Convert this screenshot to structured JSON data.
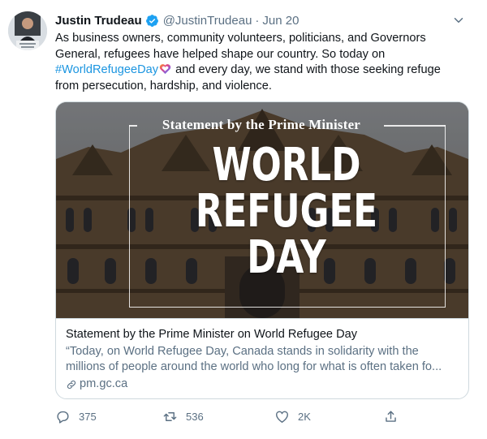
{
  "tweet": {
    "author_name": "Justin Trudeau",
    "handle": "@JustinTrudeau",
    "separator": "·",
    "timestamp": "Jun 20",
    "text_part1": "As business owners, community volunteers, politicians, and Governors General, refugees have helped shape our country. So today on ",
    "hashtag": "#WorldRefugeeDay",
    "text_part2": " and every day, we stand with those seeking refuge from persecution, hardship, and violence.",
    "accent_color": "#1b95e0"
  },
  "card": {
    "image_header": "Statement by the Prime Minister",
    "image_title_lines": [
      "WORLD",
      "REFUGEE",
      "DAY"
    ],
    "title": "Statement by the Prime Minister on World Refugee Day",
    "description": "“Today, on World Refugee Day, Canada stands in solidarity with the millions of people around the world who long for what is often taken fo...",
    "domain": "pm.gc.ca"
  },
  "actions": {
    "replies": "375",
    "retweets": "536",
    "likes": "2K"
  },
  "icons": {
    "verified": "verified-badge-icon",
    "caret": "chevron-down-icon",
    "reply": "reply-icon",
    "retweet": "retweet-icon",
    "like": "heart-icon",
    "share": "share-icon",
    "link": "link-icon"
  }
}
